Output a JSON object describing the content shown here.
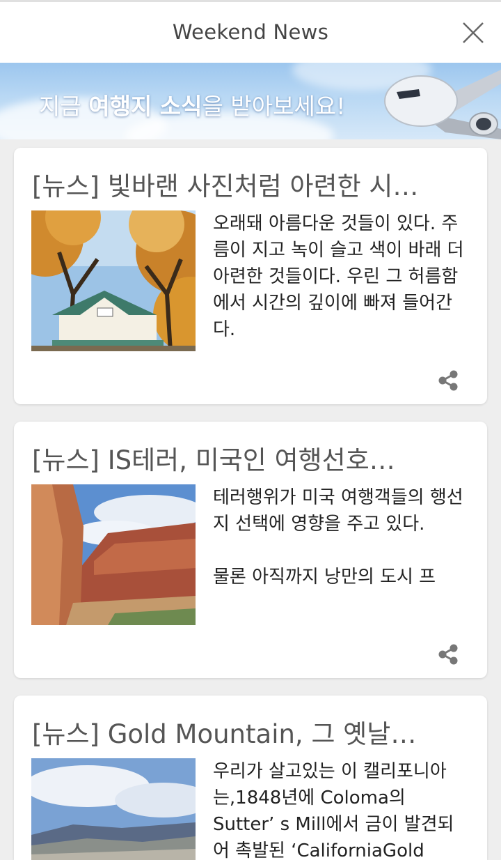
{
  "header": {
    "title": "Weekend News",
    "close_icon": "close-icon"
  },
  "banner": {
    "text_part1": "지금 ",
    "text_bold": "여행지 소식",
    "text_part2": "을 받아보세요!"
  },
  "articles": [
    {
      "headline": "[뉴스] 빛바랜 사진처럼 아련한 시…",
      "summary": "오래돼 아름다운 것들이 있다. 주름이 지고 녹이 슬고 색이 바래 더 아련한 것들이다. 우린 그 허름함에서 시간의 깊이에 빠져 들어간다.",
      "image": "autumn-station-photo",
      "share_icon": "share-icon"
    },
    {
      "headline": "[뉴스] IS테러, 미국인 여행선호…",
      "summary": "테러행위가 미국 여행객들의 행선지 선택에 영향을 주고 있다.\n\n물론 아직까지 낭만의 도시 프",
      "image": "canyon-photo",
      "share_icon": "share-icon"
    },
    {
      "headline": "[뉴스] Gold Mountain, 그 옛날…",
      "summary": "우리가 살고있는 이 캘리포니아는,1848년에 Coloma의 Sutter’ s Mill에서 금이 발견되어 촉발된 ‘CaliforniaGold",
      "image": "mountain-sky-photo",
      "share_icon": "share-icon"
    }
  ]
}
